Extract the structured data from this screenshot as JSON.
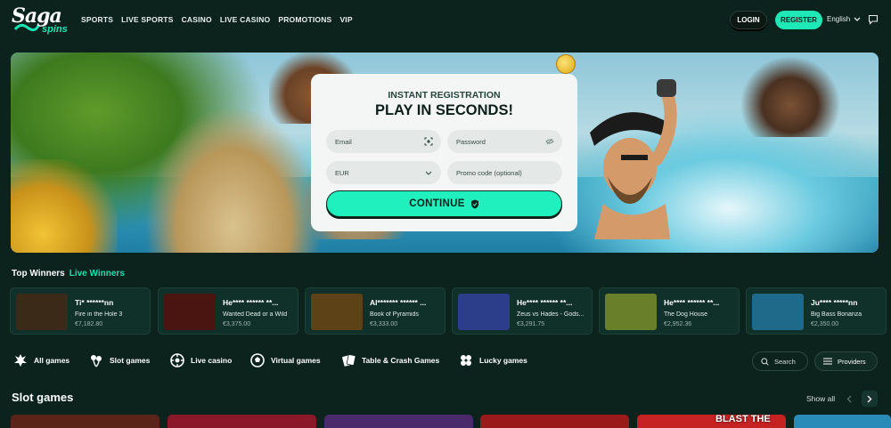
{
  "header": {
    "logo_text": "Saga",
    "logo_sub": "spins",
    "nav": [
      "SPORTS",
      "LIVE SPORTS",
      "CASINO",
      "LIVE CASINO",
      "PROMOTIONS",
      "VIP"
    ],
    "login_label": "LOGIN",
    "register_label": "REGISTER",
    "language": "English"
  },
  "registration": {
    "subtitle": "INSTANT REGISTRATION",
    "title": "PLAY IN SECONDS!",
    "email_placeholder": "Email",
    "password_placeholder": "Password",
    "currency": "EUR",
    "promo_placeholder": "Promo code (optional)",
    "continue_label": "CONTINUE"
  },
  "winners": {
    "top_label": "Top Winners",
    "live_label": "Live Winners",
    "items": [
      {
        "name": "Ti* ******nn",
        "game": "Fire in the Hole 3",
        "amount": "€7,182.80",
        "thumb": "#3b2a18"
      },
      {
        "name": "He**** ****** **...",
        "game": "Wanted Dead or a Wild",
        "amount": "€3,375.00",
        "thumb": "#4a1410"
      },
      {
        "name": "Al******* ****** ...",
        "game": "Book of Pyramids",
        "amount": "€3,333.00",
        "thumb": "#5c4216"
      },
      {
        "name": "He**** ****** **...",
        "game": "Zeus vs Hades - Gods...",
        "amount": "€3,291.75",
        "thumb": "#2c3e8a"
      },
      {
        "name": "He**** ****** **...",
        "game": "The Dog House",
        "amount": "€2,952.36",
        "thumb": "#6a7f2a"
      },
      {
        "name": "Ju**** *****nn",
        "game": "Big Bass Bonanza",
        "amount": "€2,350.00",
        "thumb": "#1f6a8a"
      }
    ]
  },
  "categories": [
    "All games",
    "Slot games",
    "Live casino",
    "Virtual games",
    "Table & Crash Games",
    "Lucky games"
  ],
  "search_label": "Search",
  "providers_label": "Providers",
  "slot_section": {
    "title": "Slot games",
    "show_all": "Show all",
    "partial_text": "BLAST THE",
    "thumb_colors": [
      "#5a2418",
      "#8a1828",
      "#4a2a6a",
      "#9a1a1a",
      "#c62222",
      "#2a8ab8"
    ]
  },
  "colors": {
    "accent": "#1fe8b7",
    "background": "#0c231d"
  }
}
